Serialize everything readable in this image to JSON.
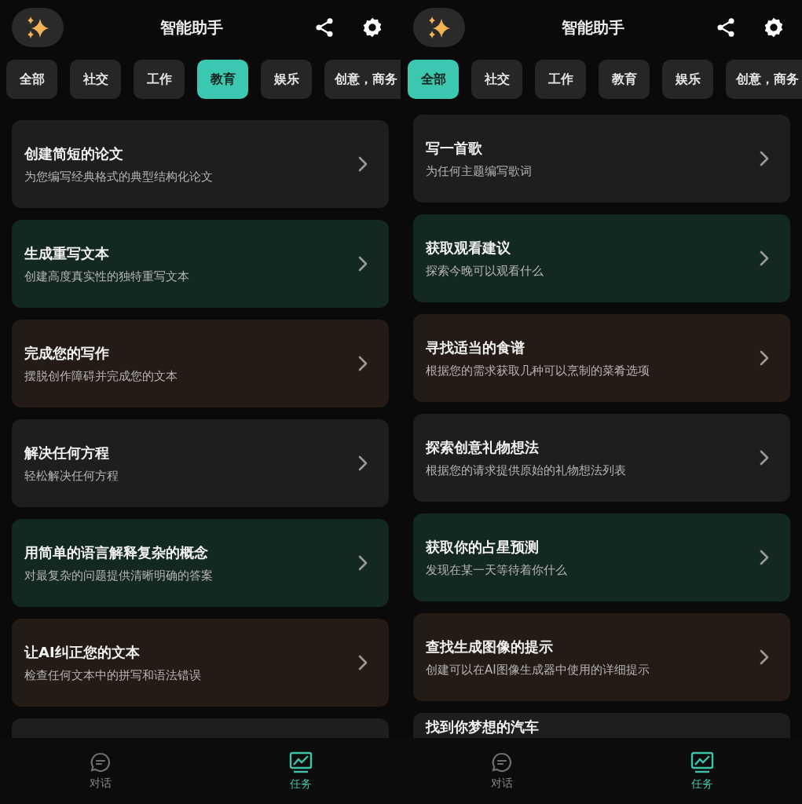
{
  "panels": [
    {
      "title": "智能助手",
      "tabs": [
        {
          "label": "全部",
          "selected": false
        },
        {
          "label": "社交",
          "selected": false
        },
        {
          "label": "工作",
          "selected": false
        },
        {
          "label": "教育",
          "selected": true
        },
        {
          "label": "娱乐",
          "selected": false
        },
        {
          "label": "创意，商务",
          "selected": false
        }
      ],
      "cards": [
        {
          "title": "创建简短的论文",
          "subtitle": "为您编写经典格式的典型结构化论文",
          "color": "#1e1e1e"
        },
        {
          "title": "生成重写文本",
          "subtitle": "创建高度真实性的独特重写文本",
          "color": "#13281f"
        },
        {
          "title": "完成您的写作",
          "subtitle": "摆脱创作障碍并完成您的文本",
          "color": "#241b16"
        },
        {
          "title": "解决任何方程",
          "subtitle": "轻松解决任何方程",
          "color": "#1e1e1e"
        },
        {
          "title": "用简单的语言解释复杂的概念",
          "subtitle": "对最复杂的问题提供清晰明确的答案",
          "color": "#13281f"
        },
        {
          "title": "让AI纠正您的文本",
          "subtitle": "检查任何文本中的拼写和语法错误",
          "color": "#241b16"
        },
        {
          "color": "#1e1e1e"
        }
      ],
      "nav": [
        {
          "label": "对话",
          "selected": false
        },
        {
          "label": "任务",
          "selected": true
        }
      ]
    },
    {
      "title": "智能助手",
      "tabs": [
        {
          "label": "全部",
          "selected": true
        },
        {
          "label": "社交",
          "selected": false
        },
        {
          "label": "工作",
          "selected": false
        },
        {
          "label": "教育",
          "selected": false
        },
        {
          "label": "娱乐",
          "selected": false
        },
        {
          "label": "创意，商务",
          "selected": false
        }
      ],
      "cards": [
        {
          "title": "写一首歌",
          "subtitle": "为任何主题编写歌词",
          "color": "#1e1e1e"
        },
        {
          "title": "获取观看建议",
          "subtitle": "探索今晚可以观看什么",
          "color": "#13281f"
        },
        {
          "title": "寻找适当的食谱",
          "subtitle": "根据您的需求获取几种可以烹制的菜肴选项",
          "color": "#241b16"
        },
        {
          "title": "探索创意礼物想法",
          "subtitle": "根据您的请求提供原始的礼物想法列表",
          "color": "#1e1e1e"
        },
        {
          "title": "获取你的占星预测",
          "subtitle": "发现在某一天等待着你什么",
          "color": "#13281f"
        },
        {
          "title": "查找生成图像的提示",
          "subtitle": "创建可以在AI图像生成器中使用的详细提示",
          "color": "#241b16"
        },
        {
          "title": "找到你梦想的汽车",
          "color": "#1e1e1e"
        }
      ],
      "nav": [
        {
          "label": "对话",
          "selected": false
        },
        {
          "label": "任务",
          "selected": true
        }
      ]
    }
  ]
}
